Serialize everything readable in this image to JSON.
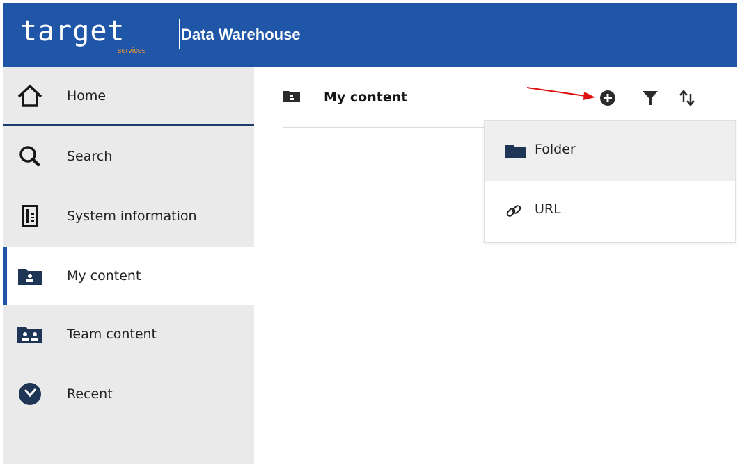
{
  "header": {
    "logo_word": "target",
    "logo_sub": "services",
    "app_title": "Data Warehouse"
  },
  "sidebar": {
    "items": [
      {
        "label": "Home",
        "icon": "home-icon"
      },
      {
        "label": "Search",
        "icon": "search-icon"
      },
      {
        "label": "System information",
        "icon": "system-information-icon"
      },
      {
        "label": "My content",
        "icon": "my-content-folder-icon",
        "selected": true
      },
      {
        "label": "Team content",
        "icon": "team-content-folder-icon"
      },
      {
        "label": "Recent",
        "icon": "recent-clock-icon"
      }
    ]
  },
  "main": {
    "title": "My content",
    "toolbar": {
      "add_icon": "add-circle-icon",
      "filter_icon": "filter-icon",
      "sort_icon": "sort-icon"
    }
  },
  "new_menu": {
    "items": [
      {
        "label": "Folder",
        "icon": "folder-icon"
      },
      {
        "label": "URL",
        "icon": "link-icon"
      }
    ]
  },
  "colors": {
    "header_bg": "#1f56a8",
    "accent": "#1f56a8",
    "sidebar_bg": "#eaeaea",
    "logo_sub": "#f29a2e",
    "annotation_arrow": "#e01010"
  }
}
